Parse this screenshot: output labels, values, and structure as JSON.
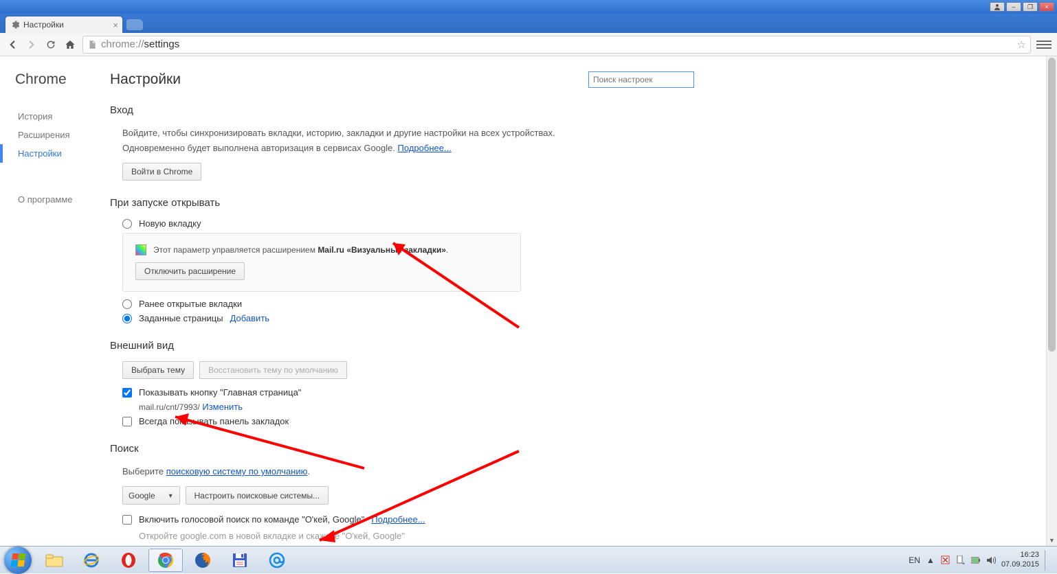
{
  "window": {
    "tab_title": "Настройки"
  },
  "omnibox": {
    "url_prefix": "chrome://",
    "url_path": "settings"
  },
  "sidebar": {
    "brand": "Chrome",
    "items": [
      {
        "label": "История"
      },
      {
        "label": "Расширения"
      },
      {
        "label": "Настройки"
      },
      {
        "label": "О программе"
      }
    ]
  },
  "settings": {
    "page_title": "Настройки",
    "search_placeholder": "Поиск настроек",
    "signin": {
      "title": "Вход",
      "desc1": "Войдите, чтобы синхронизировать вкладки, историю, закладки и другие настройки на всех устройствах.",
      "desc2": "Одновременно будет выполнена авторизация в сервисах Google. ",
      "learn_more": "Подробнее...",
      "button": "Войти в Chrome"
    },
    "startup": {
      "title": "При запуске открывать",
      "opt_newtab": "Новую вкладку",
      "notice_prefix": "Этот параметр управляется расширением ",
      "notice_ext": "Mail.ru «Визуальные закладки»",
      "notice_suffix": ".",
      "disable_btn": "Отключить расширение",
      "opt_continue": "Ранее открытые вкладки",
      "opt_pages": "Заданные страницы",
      "add_link": "Добавить"
    },
    "appearance": {
      "title": "Внешний вид",
      "theme_btn": "Выбрать тему",
      "theme_reset": "Восстановить тему по умолчанию",
      "show_home": "Показывать кнопку \"Главная страница\"",
      "home_url": "mail.ru/cnt/7993/",
      "change_link": "Изменить",
      "show_bookmarks": "Всегда показывать панель закладок"
    },
    "search": {
      "title": "Поиск",
      "choose_prefix": "Выберите ",
      "choose_link": "поисковую систему по умолчанию",
      "choose_suffix": ".",
      "engine_selected": "Google",
      "manage_btn": "Настроить поисковые системы...",
      "voice_label": "Включить голосовой поиск по команде \"О'кей, Google\"",
      "voice_more": "Подробнее...",
      "voice_hint": "Откройте google.com в новой вкладке и скажите \"О'кей, Google\""
    }
  },
  "tray": {
    "lang": "EN",
    "time": "16:23",
    "date": "07.09.2015"
  }
}
